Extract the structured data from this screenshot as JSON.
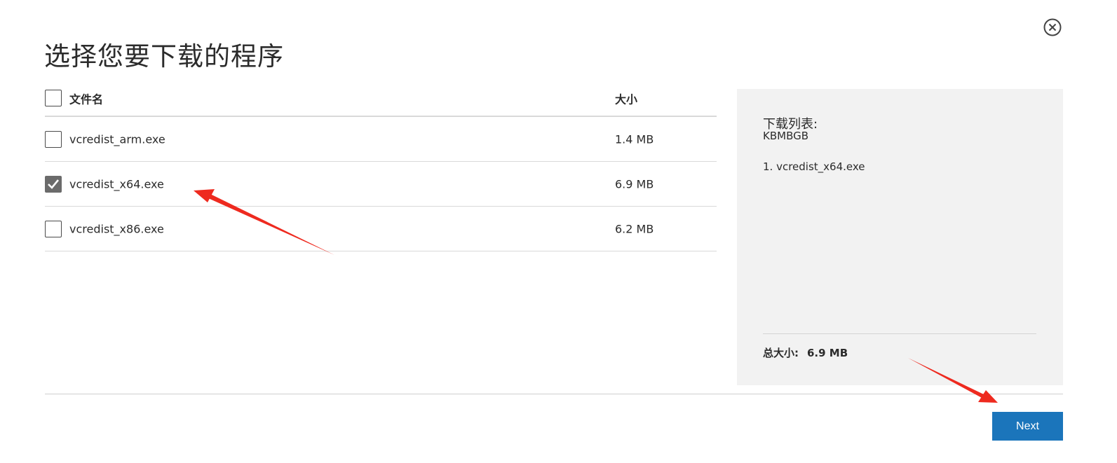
{
  "dialog": {
    "title": "选择您要下载的程序"
  },
  "table": {
    "header": {
      "name_label": "文件名",
      "size_label": "大小",
      "select_all_checked": false
    },
    "rows": [
      {
        "name": "vcredist_arm.exe",
        "size": "1.4 MB",
        "checked": false
      },
      {
        "name": "vcredist_x64.exe",
        "size": "6.9 MB",
        "checked": true
      },
      {
        "name": "vcredist_x86.exe",
        "size": "6.2 MB",
        "checked": false
      }
    ]
  },
  "summary": {
    "heading": "下载列表:",
    "subheading": "KBMBGB",
    "items": [
      "1. vcredist_x64.exe"
    ],
    "total_label": "总大小:",
    "total_value": "6.9 MB"
  },
  "actions": {
    "next_label": "Next"
  },
  "icons": {
    "close": "close-circle-icon",
    "check": "checkmark-icon"
  },
  "colors": {
    "primary_button": "#1b75bb",
    "annotation_arrow": "#ee2a1f",
    "summary_panel": "#f2f2f2"
  }
}
